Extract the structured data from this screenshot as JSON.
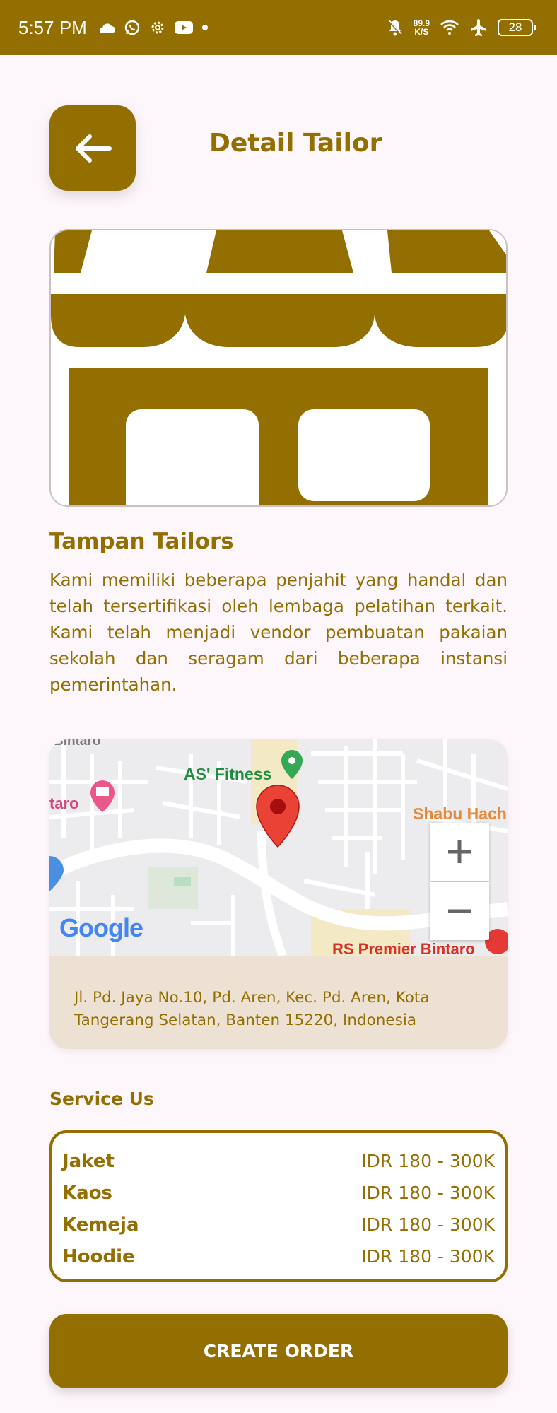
{
  "status_bar": {
    "time": "5:57 PM",
    "net_speed_value": "89.9",
    "net_speed_unit": "K/S",
    "battery": "28",
    "icons_left": [
      "cloud-icon",
      "whatsapp-icon",
      "settings-gear-icon",
      "youtube-icon",
      "dot-icon"
    ],
    "icons_right": [
      "bell-off-icon",
      "wifi-icon",
      "airplane-icon",
      "battery-icon"
    ]
  },
  "header": {
    "title": "Detail Tailor",
    "back_icon": "arrow-left-icon"
  },
  "shop": {
    "name": "Tampan Tailors",
    "description": "Kami memiliki beberapa penjahit yang handal dan telah tersertifikasi oleh lembaga pelatihan terkait. Kami telah menjadi vendor pembuatan pakaian sekolah dan seragam dari beberapa instansi pemerintahan.",
    "image_icon": "storefront-icon"
  },
  "map": {
    "labels": {
      "top": "Bintaro",
      "fitness": "AS' Fitness",
      "left": "taro",
      "shabu": "Shabu Hach",
      "hospital": "RS Premier Bintaro",
      "google": "Google"
    },
    "zoom_in": "+",
    "zoom_out": "−",
    "address": "Jl. Pd. Jaya No.10, Pd. Aren, Kec. Pd. Aren, Kota Tangerang Selatan, Banten 15220, Indonesia"
  },
  "services": {
    "title": "Service Us",
    "items": [
      {
        "name": "Jaket",
        "price": "IDR 180 - 300K"
      },
      {
        "name": "Kaos",
        "price": "IDR 180 - 300K"
      },
      {
        "name": "Kemeja",
        "price": "IDR 180 - 300K"
      },
      {
        "name": "Hoodie",
        "price": "IDR 180 - 300K"
      }
    ]
  },
  "actions": {
    "create_order": "CREATE ORDER"
  },
  "colors": {
    "brand": "#936E00",
    "background": "#FDF6FB",
    "address_bg": "#EDE1D3"
  }
}
